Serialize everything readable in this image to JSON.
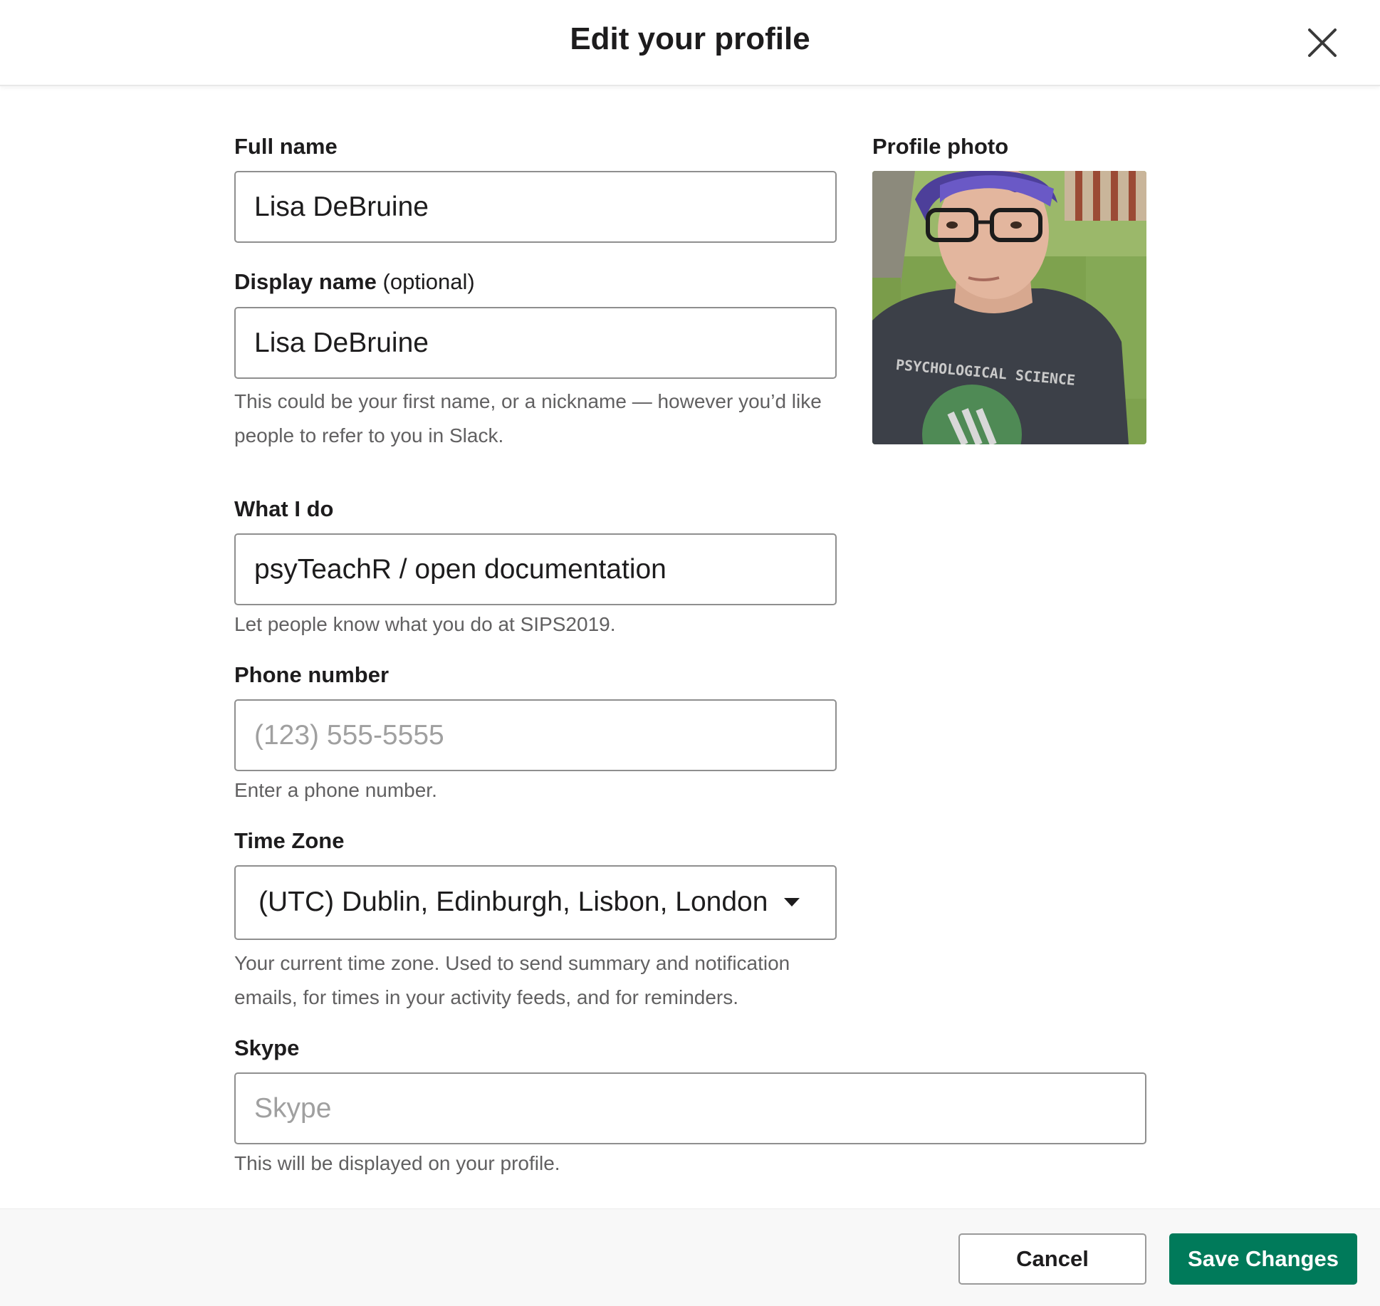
{
  "header": {
    "title": "Edit your profile",
    "close_icon": "close-icon"
  },
  "form": {
    "full_name": {
      "label": "Full name",
      "value": "Lisa DeBruine"
    },
    "display_name": {
      "label": "Display name",
      "label_suffix": "(optional)",
      "value": "Lisa DeBruine",
      "hint": "This could be your first name, or a nickname — however you’d like people to refer to you in Slack."
    },
    "what_i_do": {
      "label": "What I do",
      "value": "psyTeachR / open documentation",
      "hint": "Let people know what you do at SIPS2019."
    },
    "phone": {
      "label": "Phone number",
      "value": "",
      "placeholder": "(123) 555-5555",
      "hint": "Enter a phone number."
    },
    "time_zone": {
      "label": "Time Zone",
      "selected": "(UTC) Dublin, Edinburgh, Lisbon, London",
      "hint": "Your current time zone. Used to send summary and notification emails, for times in your activity feeds, and for reminders."
    },
    "skype": {
      "label": "Skype",
      "value": "",
      "placeholder": "Skype",
      "hint": "This will be displayed on your profile."
    }
  },
  "profile_photo": {
    "label": "Profile photo",
    "shirt_text": "PSYCHOLOGICAL SCIENCE"
  },
  "footer": {
    "cancel_label": "Cancel",
    "save_label": "Save Changes"
  },
  "colors": {
    "save_button": "#007a5a",
    "text": "#1d1c1d",
    "hint": "#616061",
    "border": "#8f8f8f"
  }
}
